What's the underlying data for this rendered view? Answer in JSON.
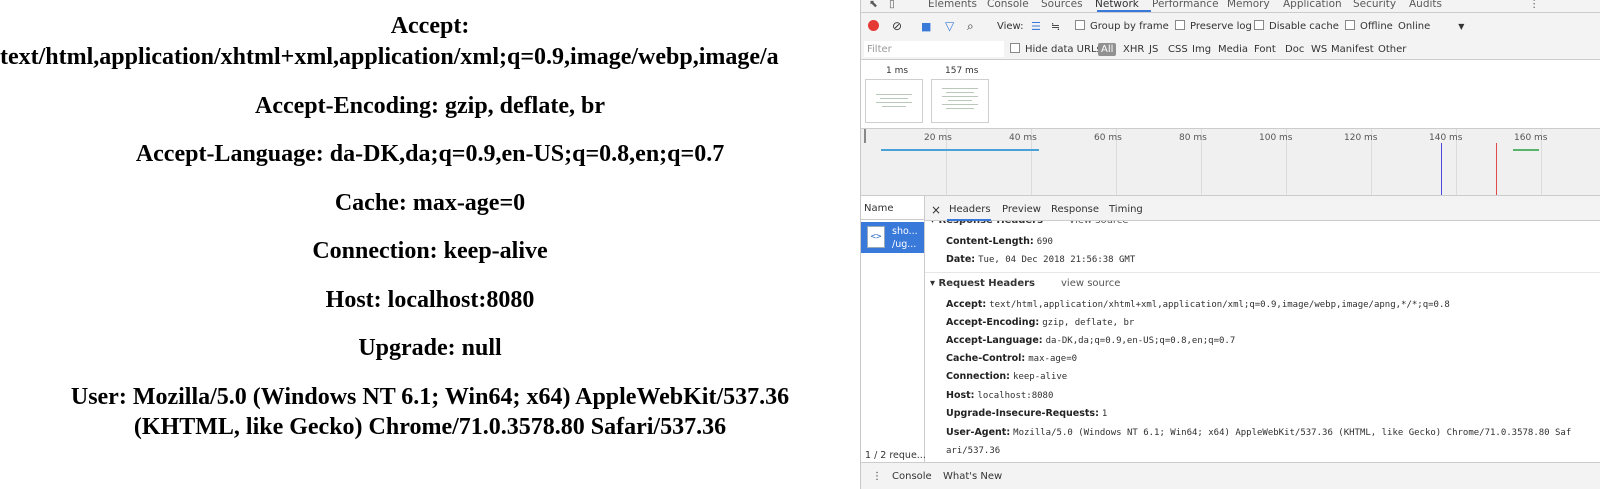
{
  "page": {
    "lines": [
      "Accept:",
      "text/html,application/xhtml+xml,application/xml;q=0.9,image/webp,image/a",
      "Accept-Encoding: gzip, deflate, br",
      "Accept-Language: da-DK,da;q=0.9,en-US;q=0.8,en;q=0.7",
      "Cache: max-age=0",
      "Connection: keep-alive",
      "Host: localhost:8080",
      "Upgrade: null",
      "User: Mozilla/5.0 (Windows NT 6.1; Win64; x64) AppleWebKit/537.36",
      "(KHTML, like Gecko) Chrome/71.0.3578.80 Safari/537.36"
    ]
  },
  "devtools": {
    "tabs": [
      "Elements",
      "Console",
      "Sources",
      "Network",
      "Performance",
      "Memory",
      "Application",
      "Security",
      "Audits"
    ],
    "active_tab": "Network",
    "accent_color": "#3879d9",
    "record_color": "#e53935",
    "toolbar": {
      "view_label": "View:",
      "group_by_frame": "Group by frame",
      "preserve_log": "Preserve log",
      "disable_cache": "Disable cache",
      "offline": "Offline",
      "throttle": "Online"
    },
    "filter": {
      "placeholder": "Filter",
      "hide_data_urls": "Hide data URLs",
      "types": [
        "All",
        "XHR",
        "JS",
        "CSS",
        "Img",
        "Media",
        "Font",
        "Doc",
        "WS",
        "Manifest",
        "Other"
      ]
    },
    "screenshots": [
      "1 ms",
      "157 ms"
    ],
    "timeline_ticks": [
      "20 ms",
      "40 ms",
      "60 ms",
      "80 ms",
      "100 ms",
      "120 ms",
      "140 ms",
      "160 ms"
    ],
    "name_column": "Name",
    "request": {
      "line1": "sho...",
      "line2": "/ug..."
    },
    "summary": "1 / 2 reque...",
    "detail_tabs": [
      "Headers",
      "Preview",
      "Response",
      "Timing"
    ],
    "response_headers_title": "Response Headers",
    "view_source": "view source",
    "response_headers": [
      {
        "key": "Content-Length:",
        "value": "690"
      },
      {
        "key": "Date:",
        "value": "Tue, 04 Dec 2018 21:56:38 GMT"
      }
    ],
    "request_headers_title": "Request Headers",
    "request_headers": [
      {
        "key": "Accept:",
        "value": "text/html,application/xhtml+xml,application/xml;q=0.9,image/webp,image/apng,*/*;q=0.8"
      },
      {
        "key": "Accept-Encoding:",
        "value": "gzip, deflate, br"
      },
      {
        "key": "Accept-Language:",
        "value": "da-DK,da;q=0.9,en-US;q=0.8,en;q=0.7"
      },
      {
        "key": "Cache-Control:",
        "value": "max-age=0"
      },
      {
        "key": "Connection:",
        "value": "keep-alive"
      },
      {
        "key": "Host:",
        "value": "localhost:8080"
      },
      {
        "key": "Upgrade-Insecure-Requests:",
        "value": "1"
      },
      {
        "key": "User-Agent:",
        "value": "Mozilla/5.0 (Windows NT 6.1; Win64; x64) AppleWebKit/537.36 (KHTML, like Gecko) Chrome/71.0.3578.80 Saf"
      },
      {
        "key": "",
        "value": "ari/537.36"
      }
    ],
    "drawer_tabs": [
      "Console",
      "What's New"
    ]
  }
}
